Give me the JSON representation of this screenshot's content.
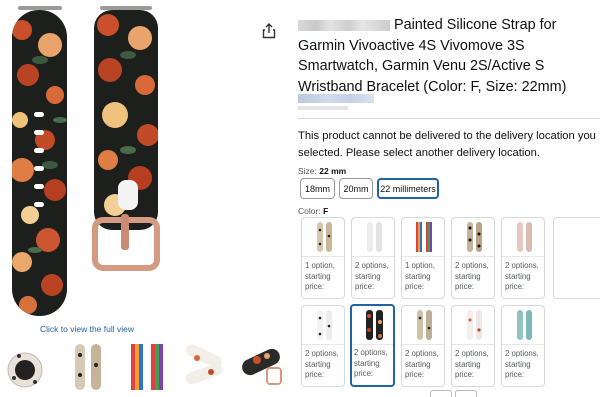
{
  "product": {
    "title_rest": "Painted Silicone Strap for Garmin Vivoactive 4S Vivomove 3S Smartwatch, Garmin Venu 2S/Active S Wristband Bracelet (Color: F, Size: 22mm)",
    "delivery_warning": "This product cannot be delivered to the delivery location you selected. Please select another delivery location."
  },
  "gallery": {
    "view_full_label": "Click to view the full view",
    "thumbnails": [
      "leopard-watch",
      "leopard-strap",
      "rainbow-strap",
      "floral-white-strap",
      "floral-dark-strap"
    ]
  },
  "size": {
    "label": "Size:",
    "selected": "22 mm",
    "options": [
      "18mm",
      "20mm",
      "22 millimeters"
    ]
  },
  "color": {
    "label": "Color:",
    "selected": "F",
    "swatches": [
      {
        "pattern": "leopard",
        "line1": "1 option,",
        "line2": "starting",
        "line3": "price:"
      },
      {
        "pattern": "white",
        "line1": "2 options,",
        "line2": "starting",
        "line3": "price:"
      },
      {
        "pattern": "rainbow",
        "line1": "1 option,",
        "line2": "starting",
        "line3": "price:"
      },
      {
        "pattern": "leopard-dark",
        "line1": "2 options,",
        "line2": "starting",
        "line3": "price:"
      },
      {
        "pattern": "pink",
        "line1": "2 options,",
        "line2": "starting",
        "line3": "price:"
      },
      {
        "pattern": "dalmatian",
        "line1": "2 options,",
        "line2": "starting",
        "line3": "price:"
      },
      {
        "pattern": "floral-dark",
        "line1": "2 options,",
        "line2": "starting",
        "line3": "price:"
      },
      {
        "pattern": "leopard-mix",
        "line1": "2 options,",
        "line2": "starting",
        "line3": "price:"
      },
      {
        "pattern": "floral-light",
        "line1": "2 options,",
        "line2": "starting",
        "line3": "price:"
      },
      {
        "pattern": "teal",
        "line1": "2 options,",
        "line2": "starting",
        "line3": "price:"
      }
    ]
  },
  "colors": {
    "link": "#2162a1",
    "selected_border": "#2162a1",
    "text": "#0f1111",
    "muted": "#565959"
  }
}
